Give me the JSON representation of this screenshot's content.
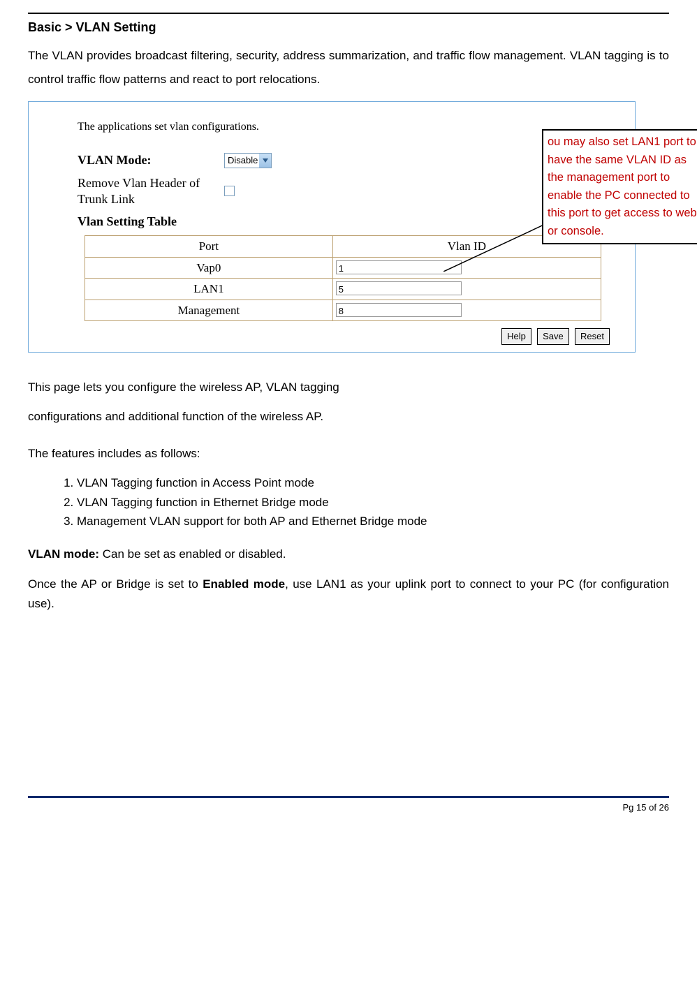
{
  "page": {
    "title": "Basic > VLAN Setting",
    "intro": "The VLAN provides broadcast filtering, security, address summarization, and traffic flow management. VLAN tagging is to control traffic flow patterns and react to port relocations.",
    "footer": "Pg 15 of 26"
  },
  "shot": {
    "subtitle": "The applications set vlan configurations.",
    "vlan_mode_label": "VLAN Mode:",
    "vlan_mode_value": "Disable",
    "remove_header_label": "Remove Vlan Header of Trunk Link",
    "table_title": "Vlan Setting Table",
    "headers": {
      "port": "Port",
      "vlanid": "Vlan ID"
    },
    "rows": [
      {
        "port": "Vap0",
        "vlan": "1"
      },
      {
        "port": "LAN1",
        "vlan": "5"
      },
      {
        "port": "Management",
        "vlan": "8"
      }
    ],
    "buttons": {
      "help": "Help",
      "save": "Save",
      "reset": "Reset"
    }
  },
  "callout": "ou may also set LAN1 port to have the same VLAN ID as the management port to enable the PC connected to this port to get access to web or console.",
  "body": {
    "p1": "This page lets you configure the wireless AP, VLAN tagging",
    "p2": "configurations and additional function of the wireless AP.",
    "p3": "The features includes as follows:",
    "features": [
      "VLAN Tagging function in Access Point mode",
      "VLAN Tagging function in Ethernet Bridge mode",
      "Management VLAN support for both AP and Ethernet Bridge mode"
    ],
    "vlan_mode_bold": "VLAN mode:",
    "vlan_mode_rest": " Can be set as enabled or disabled.",
    "enabled1": "Once the AP or Bridge is set to ",
    "enabled_bold": "Enabled mode",
    "enabled2": ", use LAN1 as your uplink port to connect to your PC (for configuration use)."
  }
}
